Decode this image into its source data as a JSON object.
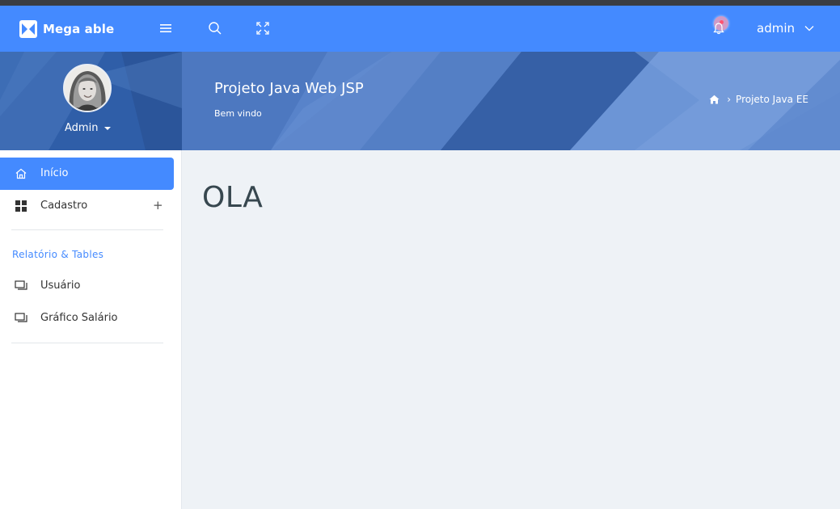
{
  "navbar": {
    "brand": "Mega able",
    "user_name": "admin",
    "colors": {
      "primary": "#448aff",
      "notification": "#ff5370"
    },
    "icons": [
      "menu-icon",
      "search-icon",
      "fullscreen-icon",
      "bell-icon",
      "chevron-down-icon"
    ]
  },
  "sidebar": {
    "profile_name": "Admin",
    "items": [
      {
        "label": "Início",
        "icon": "home-icon",
        "active": true
      },
      {
        "label": "Cadastro",
        "icon": "grid-icon",
        "expandable": "+"
      }
    ],
    "section_title": "Relatório & Tables",
    "report_items": [
      {
        "label": "Usuário",
        "icon": "window-icon"
      },
      {
        "label": "Gráfico Salário",
        "icon": "window-icon"
      }
    ]
  },
  "banner": {
    "title": "Projeto Java Web JSP",
    "subtitle": "Bem vindo",
    "breadcrumb_sep": "›",
    "breadcrumb": "Projeto Java EE"
  },
  "main": {
    "greeting": "OLA"
  }
}
